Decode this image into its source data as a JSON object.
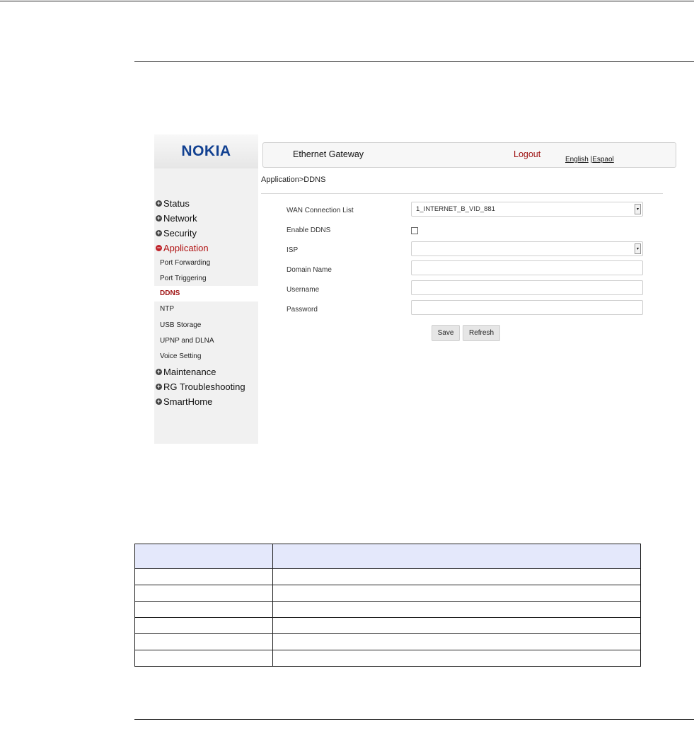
{
  "brand": {
    "logo_text": "NOKIA",
    "logo_color": "#124191"
  },
  "header": {
    "title": "Ethernet Gateway",
    "logout_label": "Logout",
    "lang_english": "English",
    "lang_sep": " |",
    "lang_espanol": "Espaol"
  },
  "breadcrumb": "Application>DDNS",
  "sidebar": {
    "status": "Status",
    "network": "Network",
    "security": "Security",
    "application": "Application",
    "sub_items": [
      "Port Forwarding",
      "Port Triggering",
      "DDNS",
      "NTP",
      "USB Storage",
      "UPNP and DLNA",
      "Voice Setting"
    ],
    "maintenance": "Maintenance",
    "troubleshooting": "RG Troubleshooting",
    "smarthome": "SmartHome",
    "active_color": "#a01515"
  },
  "form": {
    "wan_label": "WAN Connection List",
    "wan_value": "1_INTERNET_B_VID_881",
    "enable_label": "Enable DDNS",
    "enable_checked": false,
    "isp_label": "ISP",
    "isp_value": "",
    "domain_label": "Domain Name",
    "domain_value": "",
    "username_label": "Username",
    "username_value": "",
    "password_label": "Password",
    "password_value": "",
    "save_label": "Save",
    "refresh_label": "Refresh"
  },
  "table": {
    "header_fill": "#e4e8fb",
    "row_count": 6
  }
}
